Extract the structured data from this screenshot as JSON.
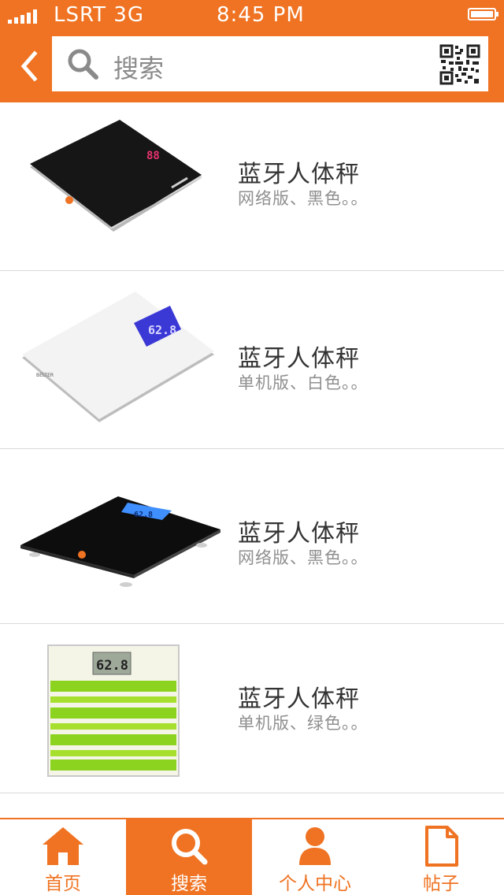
{
  "status_bar": {
    "carrier": "LSRT 3G",
    "time": "8:45 PM"
  },
  "header": {
    "search_placeholder": "搜索",
    "back_icon": "chevron-left-icon",
    "search_icon": "search-icon",
    "scan_icon": "qr-code-icon"
  },
  "products": [
    {
      "title": "蓝牙人体秤",
      "subtitle": "网络版、黑色。。"
    },
    {
      "title": "蓝牙人体秤",
      "subtitle": "单机版、白色。。"
    },
    {
      "title": "蓝牙人体秤",
      "subtitle": "网络版、黑色。。"
    },
    {
      "title": "蓝牙人体秤",
      "subtitle": "单机版、绿色。。"
    }
  ],
  "tabbar": {
    "tabs": [
      {
        "label": "首页",
        "icon": "home-icon"
      },
      {
        "label": "搜索",
        "icon": "search-icon"
      },
      {
        "label": "个人中心",
        "icon": "user-icon"
      },
      {
        "label": "帖子",
        "icon": "document-icon"
      }
    ],
    "active_tab": "搜索"
  },
  "colors": {
    "accent": "#ef7322",
    "background": "#ffffff",
    "divider": "#d9d9d9"
  }
}
